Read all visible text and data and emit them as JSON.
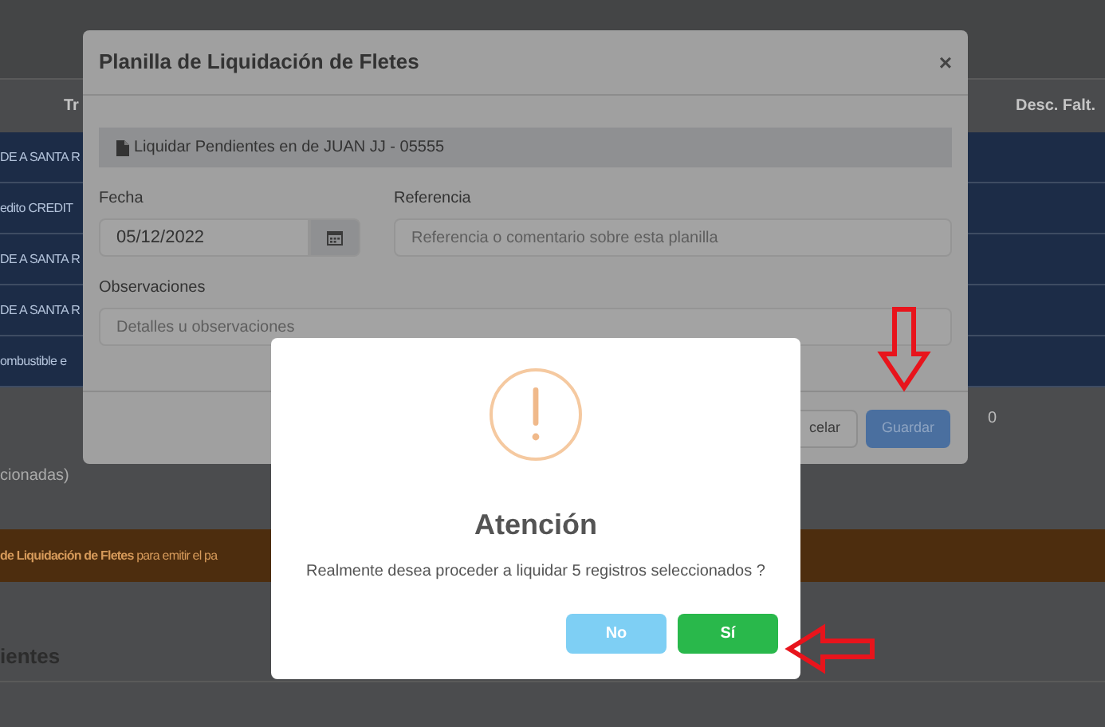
{
  "page": {
    "columns": [
      "Tr",
      "Desc. Falt."
    ],
    "rows": [
      {
        "text": "DE A SANTA R"
      },
      {
        "text": "edito CREDIT"
      },
      {
        "text": "DE A SANTA R"
      },
      {
        "text": "DE A SANTA R"
      },
      {
        "text": "ombustible e"
      }
    ],
    "total": "0",
    "selection_note": "cionadas)",
    "banner": "**de Liquidación de Fletes** para emitir el pa",
    "section_title": "ientes"
  },
  "modal": {
    "title": "Planilla de Liquidación de Fletes",
    "close": "×",
    "info": "Liquidar Pendientes en de JUAN JJ - 05555",
    "fields": [
      {
        "label": "Fecha",
        "value": "05/12/2022",
        "kind": "date"
      },
      {
        "label": "Referencia",
        "placeholder": "Referencia o comentario sobre esta planilla",
        "kind": "text"
      },
      {
        "label": "Observaciones",
        "placeholder": "Detalles u observaciones",
        "kind": "text"
      }
    ],
    "buttons": [
      {
        "label": "celar",
        "kind": "default"
      },
      {
        "label": "Guardar",
        "kind": "primary"
      }
    ]
  },
  "dialog": {
    "title": "Atención",
    "message": "Realmente desea proceder a liquidar 5 registros seleccionados ?",
    "buttons": [
      {
        "label": "No",
        "kind": "cancel"
      },
      {
        "label": "Sí",
        "kind": "confirm"
      }
    ]
  }
}
